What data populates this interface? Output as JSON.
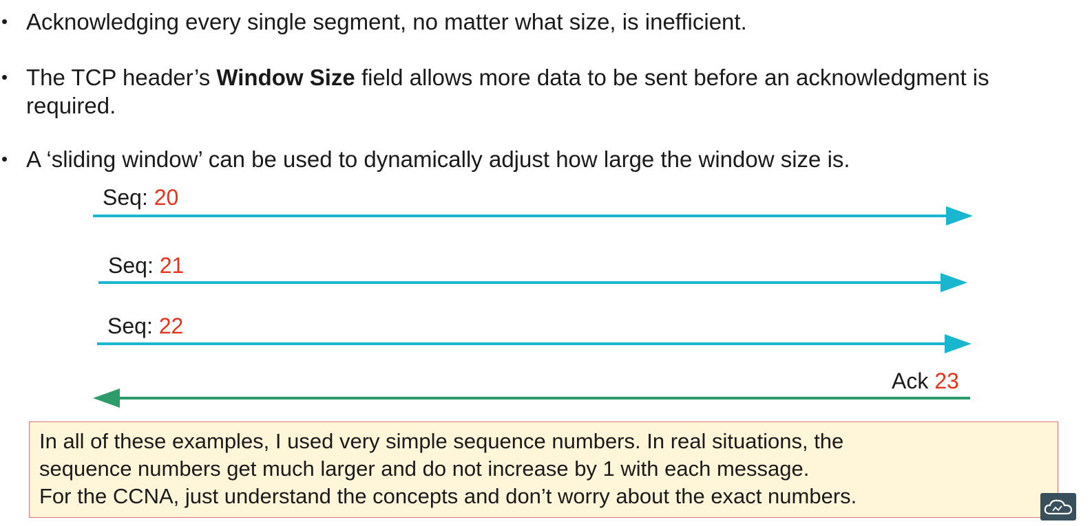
{
  "bullets": [
    {
      "text": "Acknowledging every single segment, no matter what size, is inefficient."
    },
    {
      "before": "The TCP header’s ",
      "bold": "Window Size",
      "after": " field allows more data to be sent before an acknowledgment is",
      "line2": "required."
    },
    {
      "text": "A ‘sliding window’ can be used to dynamically adjust how large the window size is."
    }
  ],
  "diagram": {
    "segments": [
      {
        "prefix": "Seq: ",
        "number": "20"
      },
      {
        "prefix": "Seq: ",
        "number": "21"
      },
      {
        "prefix": "Seq: ",
        "number": "22"
      }
    ],
    "ack": {
      "prefix": "Ack ",
      "number": "23"
    },
    "colors": {
      "seq_arrow": "#1ab6cf",
      "ack_arrow": "#2e9c6a",
      "number": "#e8321c"
    }
  },
  "note": {
    "lines": [
      "In all of these examples, I used very simple sequence numbers.  In real situations, the",
      "sequence numbers get much larger and do not increase by 1 with each message.",
      "For the CCNA, just understand the concepts and don’t worry about the exact numbers."
    ]
  },
  "logo": {
    "icon": "cloud-logo-icon"
  }
}
